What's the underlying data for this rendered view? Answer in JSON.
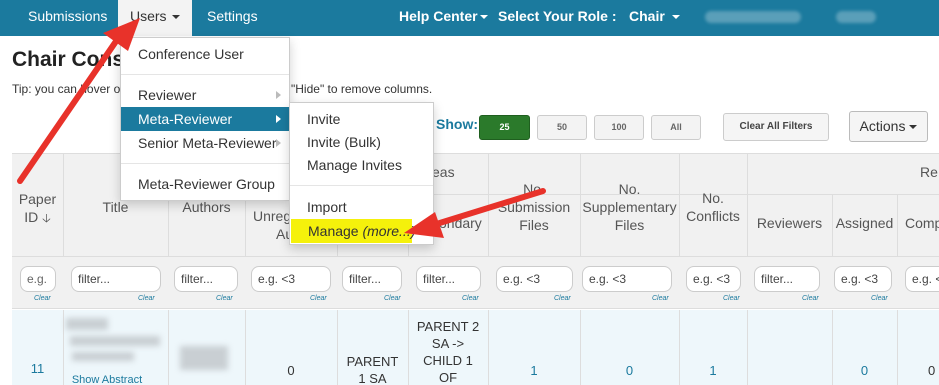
{
  "navbar": {
    "submissions": "Submissions",
    "users": "Users",
    "settings": "Settings",
    "help_center": "Help Center",
    "select_role": "Select Your Role :",
    "role": "Chair"
  },
  "page": {
    "title": "Chair Cons",
    "tip_left": "Tip: you can hover o",
    "tip_right": "\"Hide\" to remove columns."
  },
  "toolbar": {
    "show_label": "Show:",
    "page_sizes": [
      "25",
      "50",
      "100",
      "All"
    ],
    "selected_page_size": "25",
    "clear_filters": "Clear All Filters",
    "actions": "Actions"
  },
  "users_menu": {
    "items": [
      "Conference User",
      "Reviewer",
      "Meta-Reviewer",
      "Senior Meta-Reviewer",
      "Meta-Reviewer Group"
    ],
    "active": "Meta-Reviewer"
  },
  "meta_submenu": {
    "items": [
      "Invite",
      "Invite (Bulk)",
      "Manage Invites",
      "Import"
    ],
    "manage_label": "Manage",
    "manage_more": "(more...)"
  },
  "table": {
    "headers": {
      "paper_id": "Paper ID",
      "title": "Title",
      "authors": "Authors",
      "unreg_line1": "Unreg",
      "unreg_line2": "Auth",
      "areas": "eas",
      "secondary": "condary",
      "submission_files": "No. Submission Files",
      "supplementary": "No. Supplementary Files",
      "conflicts": "No. Conflicts",
      "group_cut": "Re",
      "reviewers": "Reviewers",
      "assigned": "Assigned",
      "completed": "Comp"
    },
    "filters": {
      "eg": "e.g.",
      "filter": "filter...",
      "lt3": "e.g. <3",
      "clear": "Clear"
    },
    "row": {
      "paper_id": "11",
      "show_abstract": "Show Abstract",
      "unreg": "0",
      "primary_line1": "PARENT",
      "primary_line2": "1 SA",
      "secondary_line1": "PARENT 2",
      "secondary_line2": "SA ->",
      "secondary_line3": "CHILD 1",
      "secondary_line4": "OF",
      "submission_files": "1",
      "supplementary": "0",
      "conflicts": "1",
      "assigned": "0",
      "completed": "0"
    }
  },
  "colors": {
    "navbar": "#1b7a9e",
    "active_menu": "#1b7a9e",
    "highlight": "#f5f10b",
    "arrow": "#e8322a",
    "show_button": "#2b7a2b"
  }
}
